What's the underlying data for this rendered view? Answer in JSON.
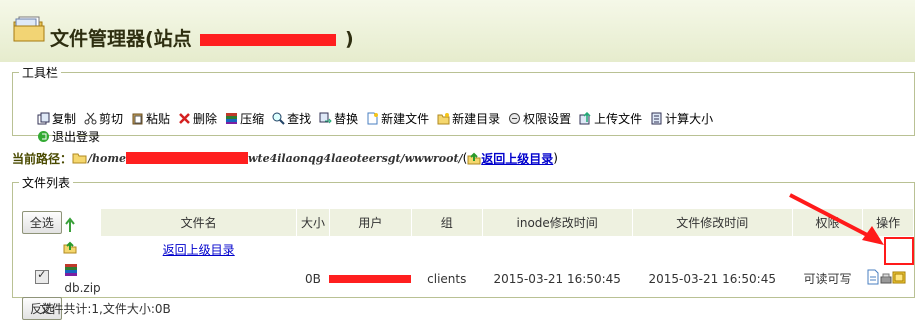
{
  "header": {
    "title_prefix": "文件管理器(站点",
    "title_suffix": ")"
  },
  "toolbar": {
    "legend": "工具栏",
    "row1": [
      {
        "label": "复制",
        "icon": "copy-icon"
      },
      {
        "label": "剪切",
        "icon": "scissors-icon"
      },
      {
        "label": "粘贴",
        "icon": "paste-icon"
      },
      {
        "label": "删除",
        "icon": "delete-icon"
      },
      {
        "label": "压缩",
        "icon": "archive-icon"
      },
      {
        "label": "查找",
        "icon": "search-icon"
      },
      {
        "label": "替换",
        "icon": "replace-icon"
      },
      {
        "label": "新建文件",
        "icon": "new-file-icon"
      },
      {
        "label": "新建目录",
        "icon": "new-folder-icon"
      },
      {
        "label": "权限设置",
        "icon": "permission-icon"
      },
      {
        "label": "上传文件",
        "icon": "upload-icon"
      },
      {
        "label": "计算大小",
        "icon": "calculate-icon"
      }
    ],
    "row2": [
      {
        "label": "退出登录",
        "icon": "logout-icon"
      }
    ]
  },
  "path": {
    "label": "当前路径：",
    "prefix": "/home",
    "suffix": "wte4ilaonqg4laeoteersgt/wwwroot/",
    "open_paren": "(",
    "back_link": "返回上级目录",
    "close_paren": ")"
  },
  "file_list": {
    "legend": "文件列表",
    "select_all": "全选",
    "invert_select": "反选",
    "columns": [
      "文件名",
      "大小",
      "用户",
      "组",
      "inode修改时间",
      "文件修改时间",
      "权限",
      "操作"
    ],
    "parent_link": "返回上级目录",
    "rows": [
      {
        "name": "db.zip",
        "size": "0B",
        "group": "clients",
        "inode_time": "2015-03-21 16:50:45",
        "mtime": "2015-03-21 16:50:45",
        "perm": "可读可写",
        "checked": true
      }
    ],
    "summary": "文件共计:1,文件大小:0B"
  },
  "colors": {
    "redaction": "#ff1f1f",
    "annotation": "#ff1a1a",
    "header_bg": "#eef1e0"
  }
}
